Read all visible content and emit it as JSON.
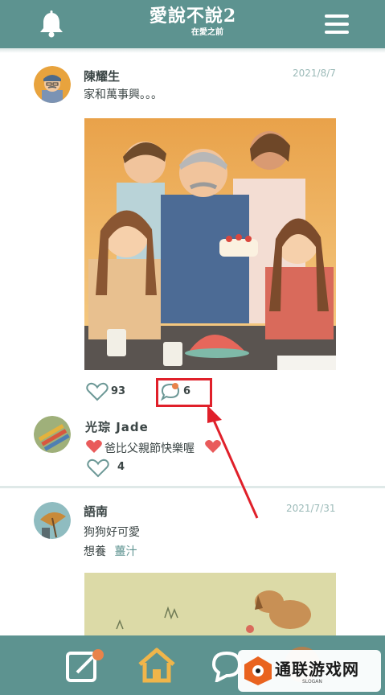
{
  "header": {
    "title": "愛說不說2",
    "subtitle": "在愛之前",
    "bell_icon": "bell-icon",
    "menu_icon": "hamburger-menu-icon",
    "color": "#5d9390"
  },
  "posts": [
    {
      "username": "陳耀生",
      "date": "2021/8/7",
      "text": "家和萬事興。。。",
      "likes": "93",
      "comments": "6"
    },
    {
      "username": "語南",
      "date": "2021/7/31",
      "text": "狗狗好可愛",
      "adopt_label": "想養",
      "adopt_link": "薑汁"
    }
  ],
  "comment": {
    "username": "光琮 Jade",
    "text": "爸比父親節快樂喔",
    "likes": "4"
  },
  "bottom_nav": {
    "items": [
      "compose-icon",
      "home-icon",
      "chat-icon",
      "profile-avatar"
    ]
  },
  "watermark": {
    "text": "通联游戏网",
    "slogan": "SLOGAN"
  },
  "colors": {
    "accent": "#5d9390",
    "highlight": "#e0202a",
    "date": "#9bbab8",
    "link": "#5d9390"
  }
}
